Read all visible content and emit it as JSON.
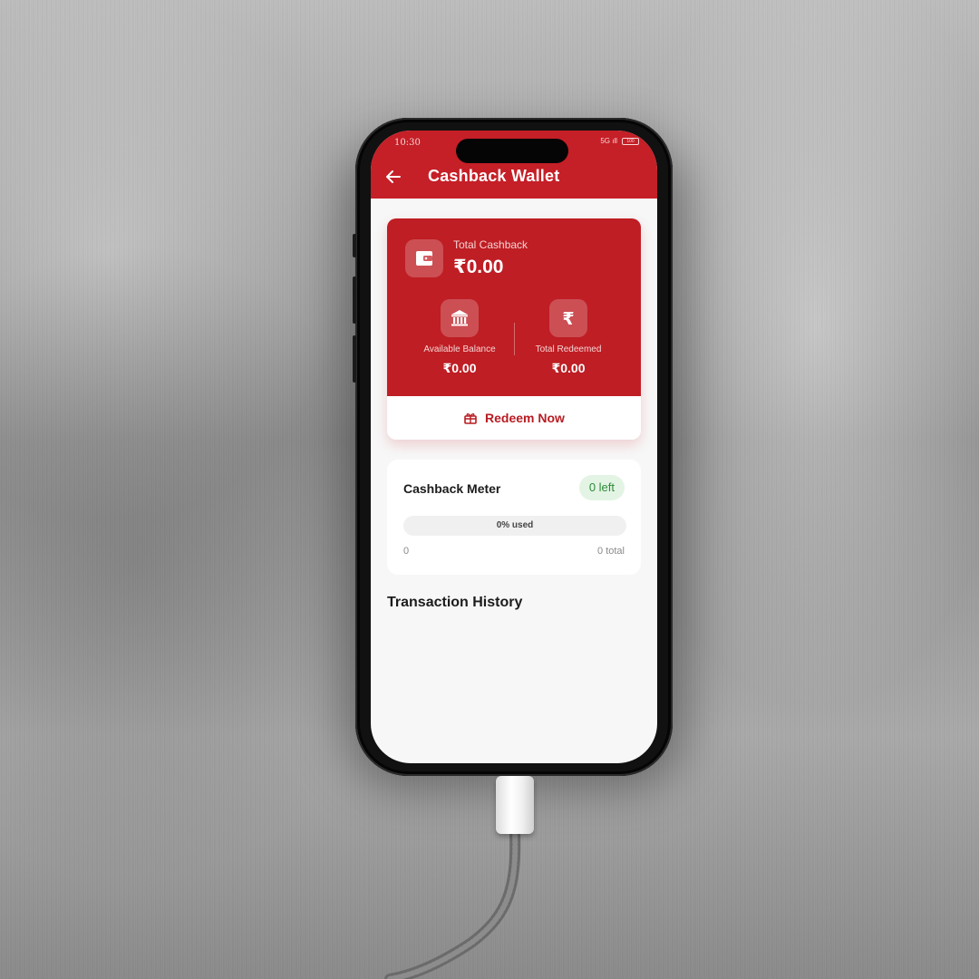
{
  "status_bar": {
    "time": "10:30",
    "signal": "5G ıll",
    "battery": "100"
  },
  "header": {
    "title": "Cashback Wallet"
  },
  "wallet": {
    "total_label": "Total Cashback",
    "total_value": "₹0.00",
    "available_label": "Available Balance",
    "available_value": "₹0.00",
    "redeemed_label": "Total Redeemed",
    "redeemed_value": "₹0.00",
    "redeem_button": "Redeem Now"
  },
  "meter": {
    "title": "Cashback Meter",
    "left_badge": "0 left",
    "progress_percent": 0,
    "progress_text": "0% used",
    "min_label": "0",
    "max_label": "0 total"
  },
  "transactions": {
    "title": "Transaction History"
  },
  "colors": {
    "brand_red": "#c51f27",
    "badge_green_bg": "#e3f4e4",
    "badge_green_text": "#2e8b3a"
  },
  "icons": [
    "back-arrow-icon",
    "wallet-icon",
    "bank-icon",
    "rupee-icon",
    "gift-icon"
  ]
}
